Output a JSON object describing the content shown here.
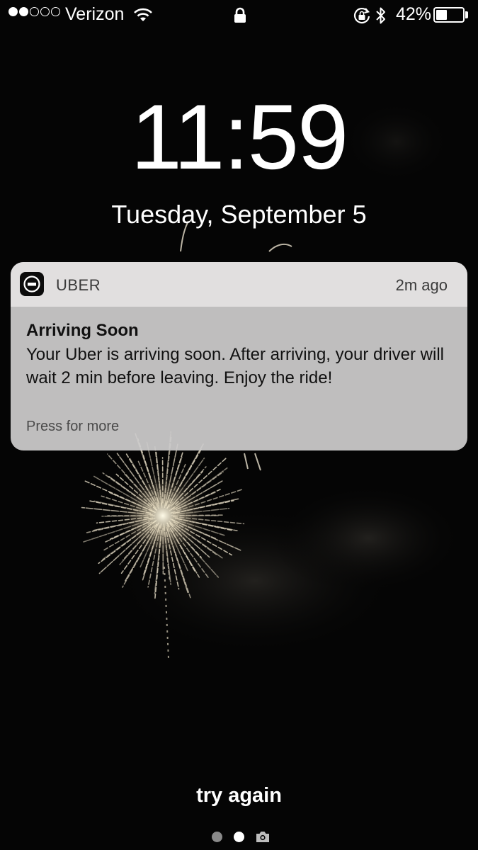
{
  "status_bar": {
    "signal_bars_filled": 2,
    "signal_bars_total": 5,
    "carrier": "Verizon",
    "battery_percent": "42%",
    "battery_level": 0.42,
    "icons": [
      "wifi-icon",
      "lock-icon",
      "orientation-lock-icon",
      "bluetooth-icon",
      "battery-icon"
    ]
  },
  "lock_screen": {
    "time": "11:59",
    "date": "Tuesday, September 5"
  },
  "notification": {
    "app_icon": "uber-app-icon",
    "app_name": "UBER",
    "time_ago": "2m ago",
    "title": "Arriving Soon",
    "body": "Your Uber is arriving soon. After arriving, your driver will wait 2 min before leaving. Enjoy the ride!",
    "footer": "Press for more"
  },
  "bottom": {
    "prompt": "try again",
    "page_indicator_count": 2,
    "page_indicator_active": 2,
    "camera_icon": "camera-icon"
  },
  "colors": {
    "background": "#050505",
    "notification_body": "#cecccc",
    "notification_header": "#e2e0e0",
    "text_dark": "#111111"
  }
}
